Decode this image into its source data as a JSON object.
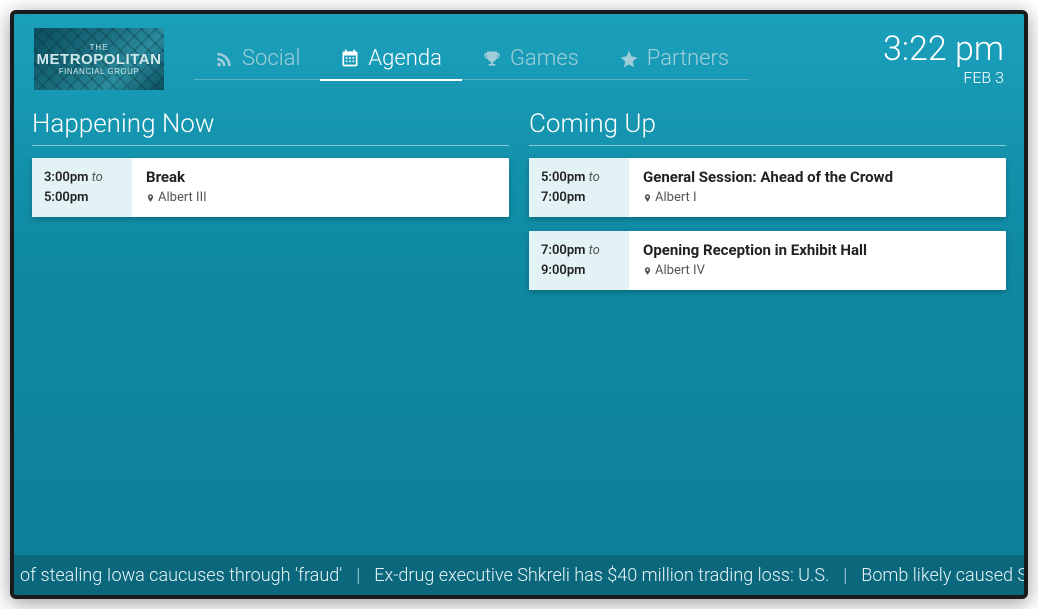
{
  "logo": {
    "line1": "THE",
    "line2": "METROPOLITAN",
    "line3": "FINANCIAL GROUP"
  },
  "tabs": [
    {
      "id": "social",
      "label": "Social",
      "icon": "rss-icon",
      "active": false
    },
    {
      "id": "agenda",
      "label": "Agenda",
      "icon": "calendar-icon",
      "active": true
    },
    {
      "id": "games",
      "label": "Games",
      "icon": "trophy-icon",
      "active": false
    },
    {
      "id": "partners",
      "label": "Partners",
      "icon": "star-icon",
      "active": false
    }
  ],
  "clock": {
    "time": "3:22 pm",
    "date": "FEB 3"
  },
  "sections": {
    "now": {
      "title": "Happening Now",
      "events": [
        {
          "start": "3:00pm",
          "end": "5:00pm",
          "title": "Break",
          "location": "Albert III"
        }
      ]
    },
    "upcoming": {
      "title": "Coming Up",
      "events": [
        {
          "start": "5:00pm",
          "end": "7:00pm",
          "title": "General Session: Ahead of the Crowd",
          "location": "Albert I"
        },
        {
          "start": "7:00pm",
          "end": "9:00pm",
          "title": "Opening Reception in Exhibit Hall",
          "location": "Albert IV"
        }
      ]
    }
  },
  "ticker": {
    "to_word": "to",
    "separator": "|",
    "items": [
      "of stealing Iowa caucuses through 'fraud'",
      "Ex-drug executive Shkreli has $40 million trading loss: U.S.",
      "Bomb likely caused S"
    ]
  }
}
